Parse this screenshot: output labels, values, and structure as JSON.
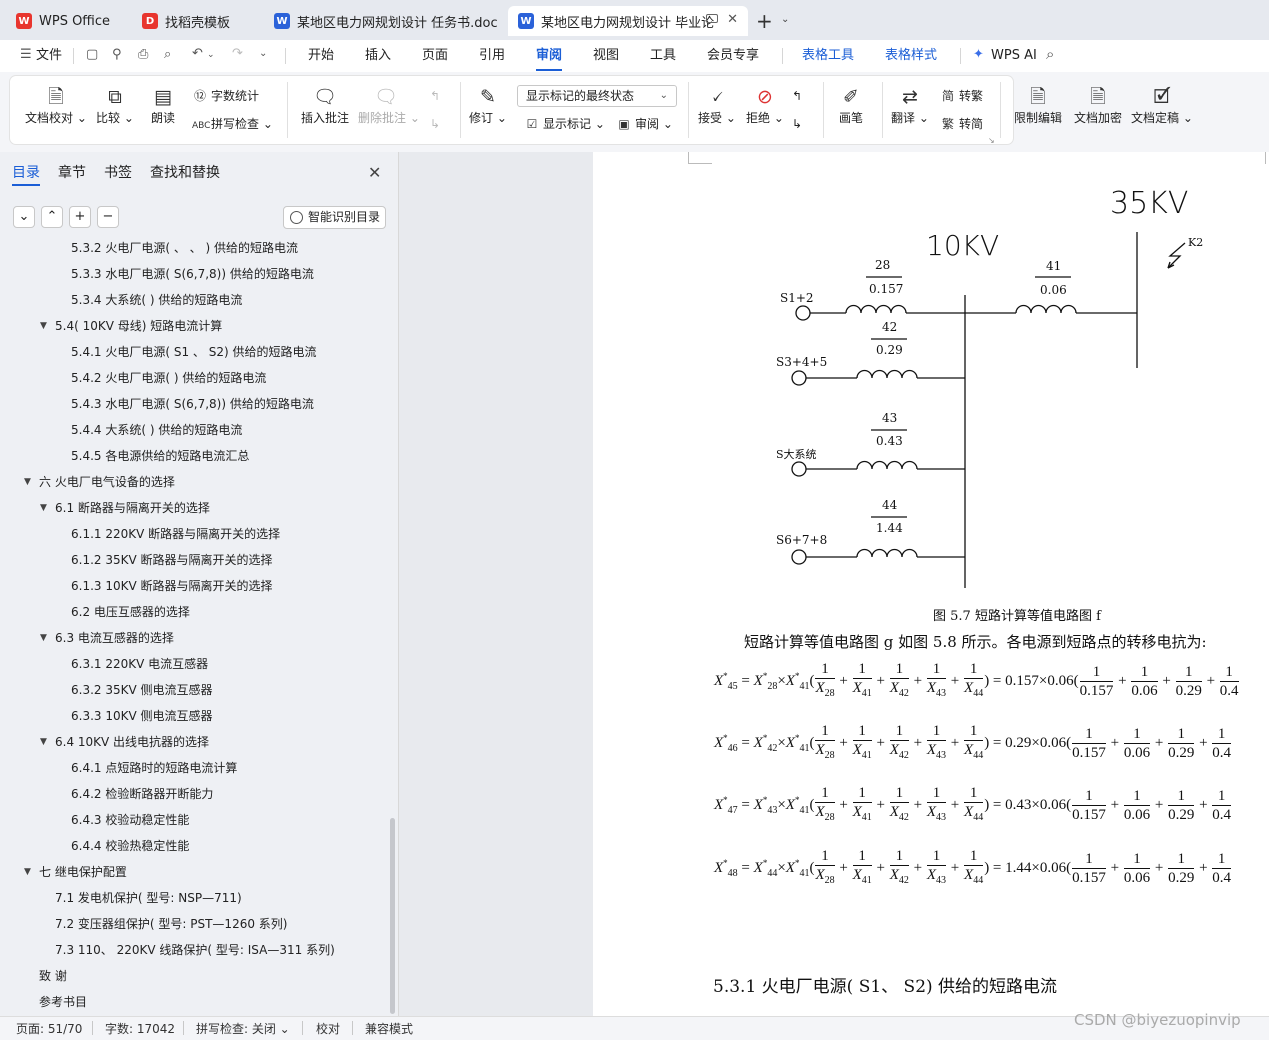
{
  "tabs": [
    {
      "label": "WPS Office",
      "icon": "wps-logo-icon",
      "icon_color": "#e8352e"
    },
    {
      "label": "找稻壳模板",
      "icon": "docer-icon",
      "icon_color": "#e8352e"
    },
    {
      "label": "某地区电力网规划设计 任务书.doc",
      "icon": "word-doc-icon",
      "icon_color": "#2b62d9"
    },
    {
      "label": "某地区电力网规划设计 毕业论",
      "icon": "word-doc-icon",
      "icon_color": "#2b62d9",
      "active": true
    }
  ],
  "new_tab": "+",
  "menu": {
    "file": "文件",
    "items": [
      "开始",
      "插入",
      "页面",
      "引用",
      "审阅",
      "视图",
      "工具",
      "会员专享"
    ],
    "active": "审阅",
    "context_tabs": [
      "表格工具",
      "表格样式"
    ],
    "wps_ai": "WPS AI"
  },
  "ribbon": {
    "proofread": "文档校对",
    "compare": "比较",
    "read_aloud": "朗读",
    "word_count": "字数统计",
    "spell_check": "拼写检查",
    "insert_comment": "插入批注",
    "delete_comment": "删除批注",
    "revise": "修订",
    "markup_mode": "显示标记的最终状态",
    "show_markup": "显示标记",
    "review": "审阅",
    "accept": "接受",
    "reject": "拒绝",
    "ink": "画笔",
    "translate": "翻译",
    "to_traditional": "转繁",
    "to_simplified": "转简",
    "restrict_edit": "限制编辑",
    "encrypt": "文档加密",
    "finalize": "文档定稿"
  },
  "nav": {
    "tabs": [
      "目录",
      "章节",
      "书签",
      "查找和替换"
    ],
    "active_tab": "目录",
    "smart_toc": "智能识别目录",
    "toc": [
      {
        "text": "5.3.2 火电厂电源(  、  、  ) 供给的短路电流",
        "level": 3
      },
      {
        "text": "5.3.3 水电厂电源( S(6,7,8)) 供给的短路电流",
        "level": 3
      },
      {
        "text": "5.3.4 大系统( ) 供给的短路电流",
        "level": 3
      },
      {
        "text": "5.4( 10KV 母线) 短路电流计算",
        "level": 2,
        "expanded": true
      },
      {
        "text": "5.4.1 火电厂电源( S1  、  S2) 供给的短路电流",
        "level": 3
      },
      {
        "text": "5.4.2 火电厂电源( ) 供给的短路电流",
        "level": 3
      },
      {
        "text": "5.4.3 水电厂电源( S(6,7,8)) 供给的短路电流",
        "level": 3
      },
      {
        "text": "5.4.4 大系统( ) 供给的短路电流",
        "level": 3
      },
      {
        "text": "5.4.5 各电源供给的短路电流汇总",
        "level": 3
      },
      {
        "text": "六   火电厂电气设备的选择",
        "level": 1,
        "expanded": true
      },
      {
        "text": "6.1 断路器与隔离开关的选择",
        "level": 2,
        "expanded": true
      },
      {
        "text": "6.1.1 220KV 断路器与隔离开关的选择",
        "level": 3
      },
      {
        "text": "6.1.2 35KV 断路器与隔离开关的选择",
        "level": 3
      },
      {
        "text": "6.1.3 10KV 断路器与隔离开关的选择",
        "level": 3
      },
      {
        "text": "6.2 电压互感器的选择",
        "level": 3
      },
      {
        "text": "6.3 电流互感器的选择",
        "level": 2,
        "expanded": true
      },
      {
        "text": "6.3.1 220KV 电流互感器",
        "level": 3
      },
      {
        "text": "6.3.2 35KV 侧电流互感器",
        "level": 3
      },
      {
        "text": "6.3.3 10KV 侧电流互感器",
        "level": 3
      },
      {
        "text": "6.4 10KV 出线电抗器的选择",
        "level": 2,
        "expanded": true
      },
      {
        "text": "6.4.1  点短路时的短路电流计算",
        "level": 3
      },
      {
        "text": "6.4.2  检验断路器开断能力",
        "level": 3
      },
      {
        "text": "6.4.3  校验动稳定性能",
        "level": 3
      },
      {
        "text": "6.4.4  校验热稳定性能",
        "level": 3
      },
      {
        "text": "七   继电保护配置",
        "level": 1,
        "expanded": true
      },
      {
        "text": "7.1  发电机保护( 型号: NSP—711)",
        "level": 2
      },
      {
        "text": "7.2  变压器组保护( 型号: PST—1260 系列)",
        "level": 2
      },
      {
        "text": "7.3 110、 220KV 线路保护( 型号: ISA—311 系列)",
        "level": 2
      },
      {
        "text": "致   谢",
        "level": 1
      },
      {
        "text": "参考书目",
        "level": 1
      }
    ]
  },
  "document": {
    "diagram": {
      "bus_35kv": "35KV",
      "bus_10kv": "10KV",
      "fault_label": "K2",
      "branches": [
        {
          "source": "S1+2",
          "id": "28",
          "value": "0.157"
        },
        {
          "source": "",
          "id": "41",
          "value": "0.06"
        },
        {
          "source": "S3+4+5",
          "id": "42",
          "value": "0.29"
        },
        {
          "source": "S大系统",
          "id": "43",
          "value": "0.43"
        },
        {
          "source": "S6+7+8",
          "id": "44",
          "value": "1.44"
        }
      ]
    },
    "figure_caption": "图 5.7 短路计算等值电路图 f",
    "body_text": "短路计算等值电路图 g 如图 5.8 所示。各电源到短路点的转移电抗为:",
    "equations": [
      {
        "lhs": "45",
        "x1": "28",
        "coef": "0.157×0.06("
      },
      {
        "lhs": "46",
        "x1": "42",
        "coef": "0.29×0.06("
      },
      {
        "lhs": "47",
        "x1": "43",
        "coef": "0.43×0.06("
      },
      {
        "lhs": "48",
        "x1": "44",
        "coef": "1.44×0.06("
      }
    ],
    "eq_denominators": [
      "28",
      "41",
      "42",
      "43",
      "44"
    ],
    "eq_numeric_denoms": [
      "0.157",
      "0.06",
      "0.29"
    ],
    "heading": "5.3.1 火电厂电源( S1、  S2)  供给的短路电流"
  },
  "status": {
    "page": "页面: 51/70",
    "words": "字数: 17042",
    "spell": "拼写检查: 关闭",
    "proof": "校对",
    "compat": "兼容模式"
  },
  "watermark": "CSDN @biyezuopinvip"
}
